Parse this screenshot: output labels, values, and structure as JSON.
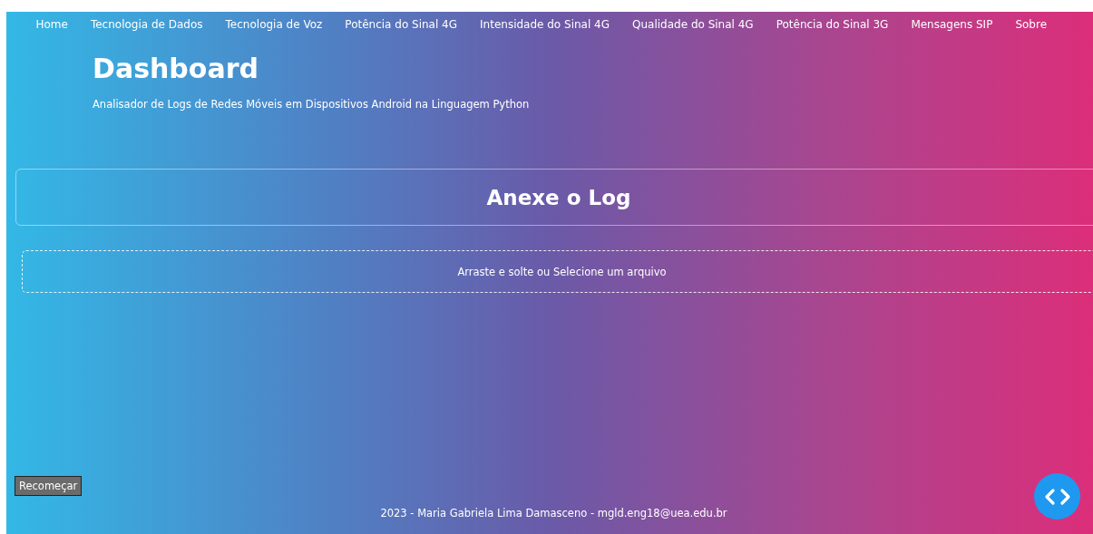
{
  "nav": [
    {
      "label": "Home"
    },
    {
      "label": "Tecnologia de Dados"
    },
    {
      "label": "Tecnologia de Voz"
    },
    {
      "label": "Potência do Sinal 4G"
    },
    {
      "label": "Intensidade do Sinal 4G"
    },
    {
      "label": "Qualidade do Sinal 4G"
    },
    {
      "label": "Potência do Sinal 3G"
    },
    {
      "label": "Mensagens SIP"
    },
    {
      "label": "Sobre"
    }
  ],
  "header": {
    "title": "Dashboard",
    "subtitle": "Analisador de Logs de Redes Móveis em Dispositivos Android na Linguagem Python"
  },
  "upload": {
    "title": "Anexe o Log",
    "dropzone": "Arraste e solte ou Selecione um arquivo"
  },
  "restart_button": "Recomeçar",
  "footer": "2023 - Maria Gabriela Lima Damasceno - mgld.eng18@uea.edu.br"
}
